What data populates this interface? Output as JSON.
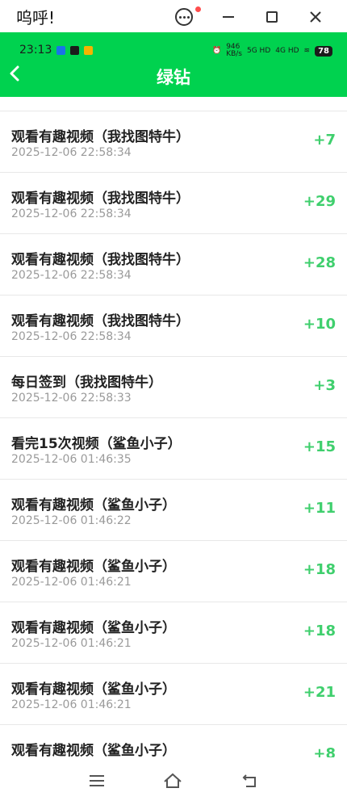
{
  "window": {
    "title": "呜呼!"
  },
  "status_bar": {
    "time": "23:13",
    "net_speed": "946\nKB/s",
    "signal_labels": [
      "5G HD",
      "4G HD"
    ],
    "battery": "78",
    "colors": {
      "header": "#00d24f"
    }
  },
  "header": {
    "title": "绿钻"
  },
  "records": [
    {
      "title": "观看有趣视频（我找图特牛）",
      "time": "2025-12-06 22:58:34",
      "amount": "+7"
    },
    {
      "title": "观看有趣视频（我找图特牛）",
      "time": "2025-12-06 22:58:34",
      "amount": "+29"
    },
    {
      "title": "观看有趣视频（我找图特牛）",
      "time": "2025-12-06 22:58:34",
      "amount": "+28"
    },
    {
      "title": "观看有趣视频（我找图特牛）",
      "time": "2025-12-06 22:58:34",
      "amount": "+10"
    },
    {
      "title": "每日签到（我找图特牛）",
      "time": "2025-12-06 22:58:33",
      "amount": "+3"
    },
    {
      "title": "看完15次视频（鲨鱼小子）",
      "time": "2025-12-06 01:46:35",
      "amount": "+15"
    },
    {
      "title": "观看有趣视频（鲨鱼小子）",
      "time": "2025-12-06 01:46:22",
      "amount": "+11"
    },
    {
      "title": "观看有趣视频（鲨鱼小子）",
      "time": "2025-12-06 01:46:21",
      "amount": "+18"
    },
    {
      "title": "观看有趣视频（鲨鱼小子）",
      "time": "2025-12-06 01:46:21",
      "amount": "+18"
    },
    {
      "title": "观看有趣视频（鲨鱼小子）",
      "time": "2025-12-06 01:46:21",
      "amount": "+21"
    },
    {
      "title": "观看有趣视频（鲨鱼小子）",
      "time": "",
      "amount": "+8"
    }
  ]
}
